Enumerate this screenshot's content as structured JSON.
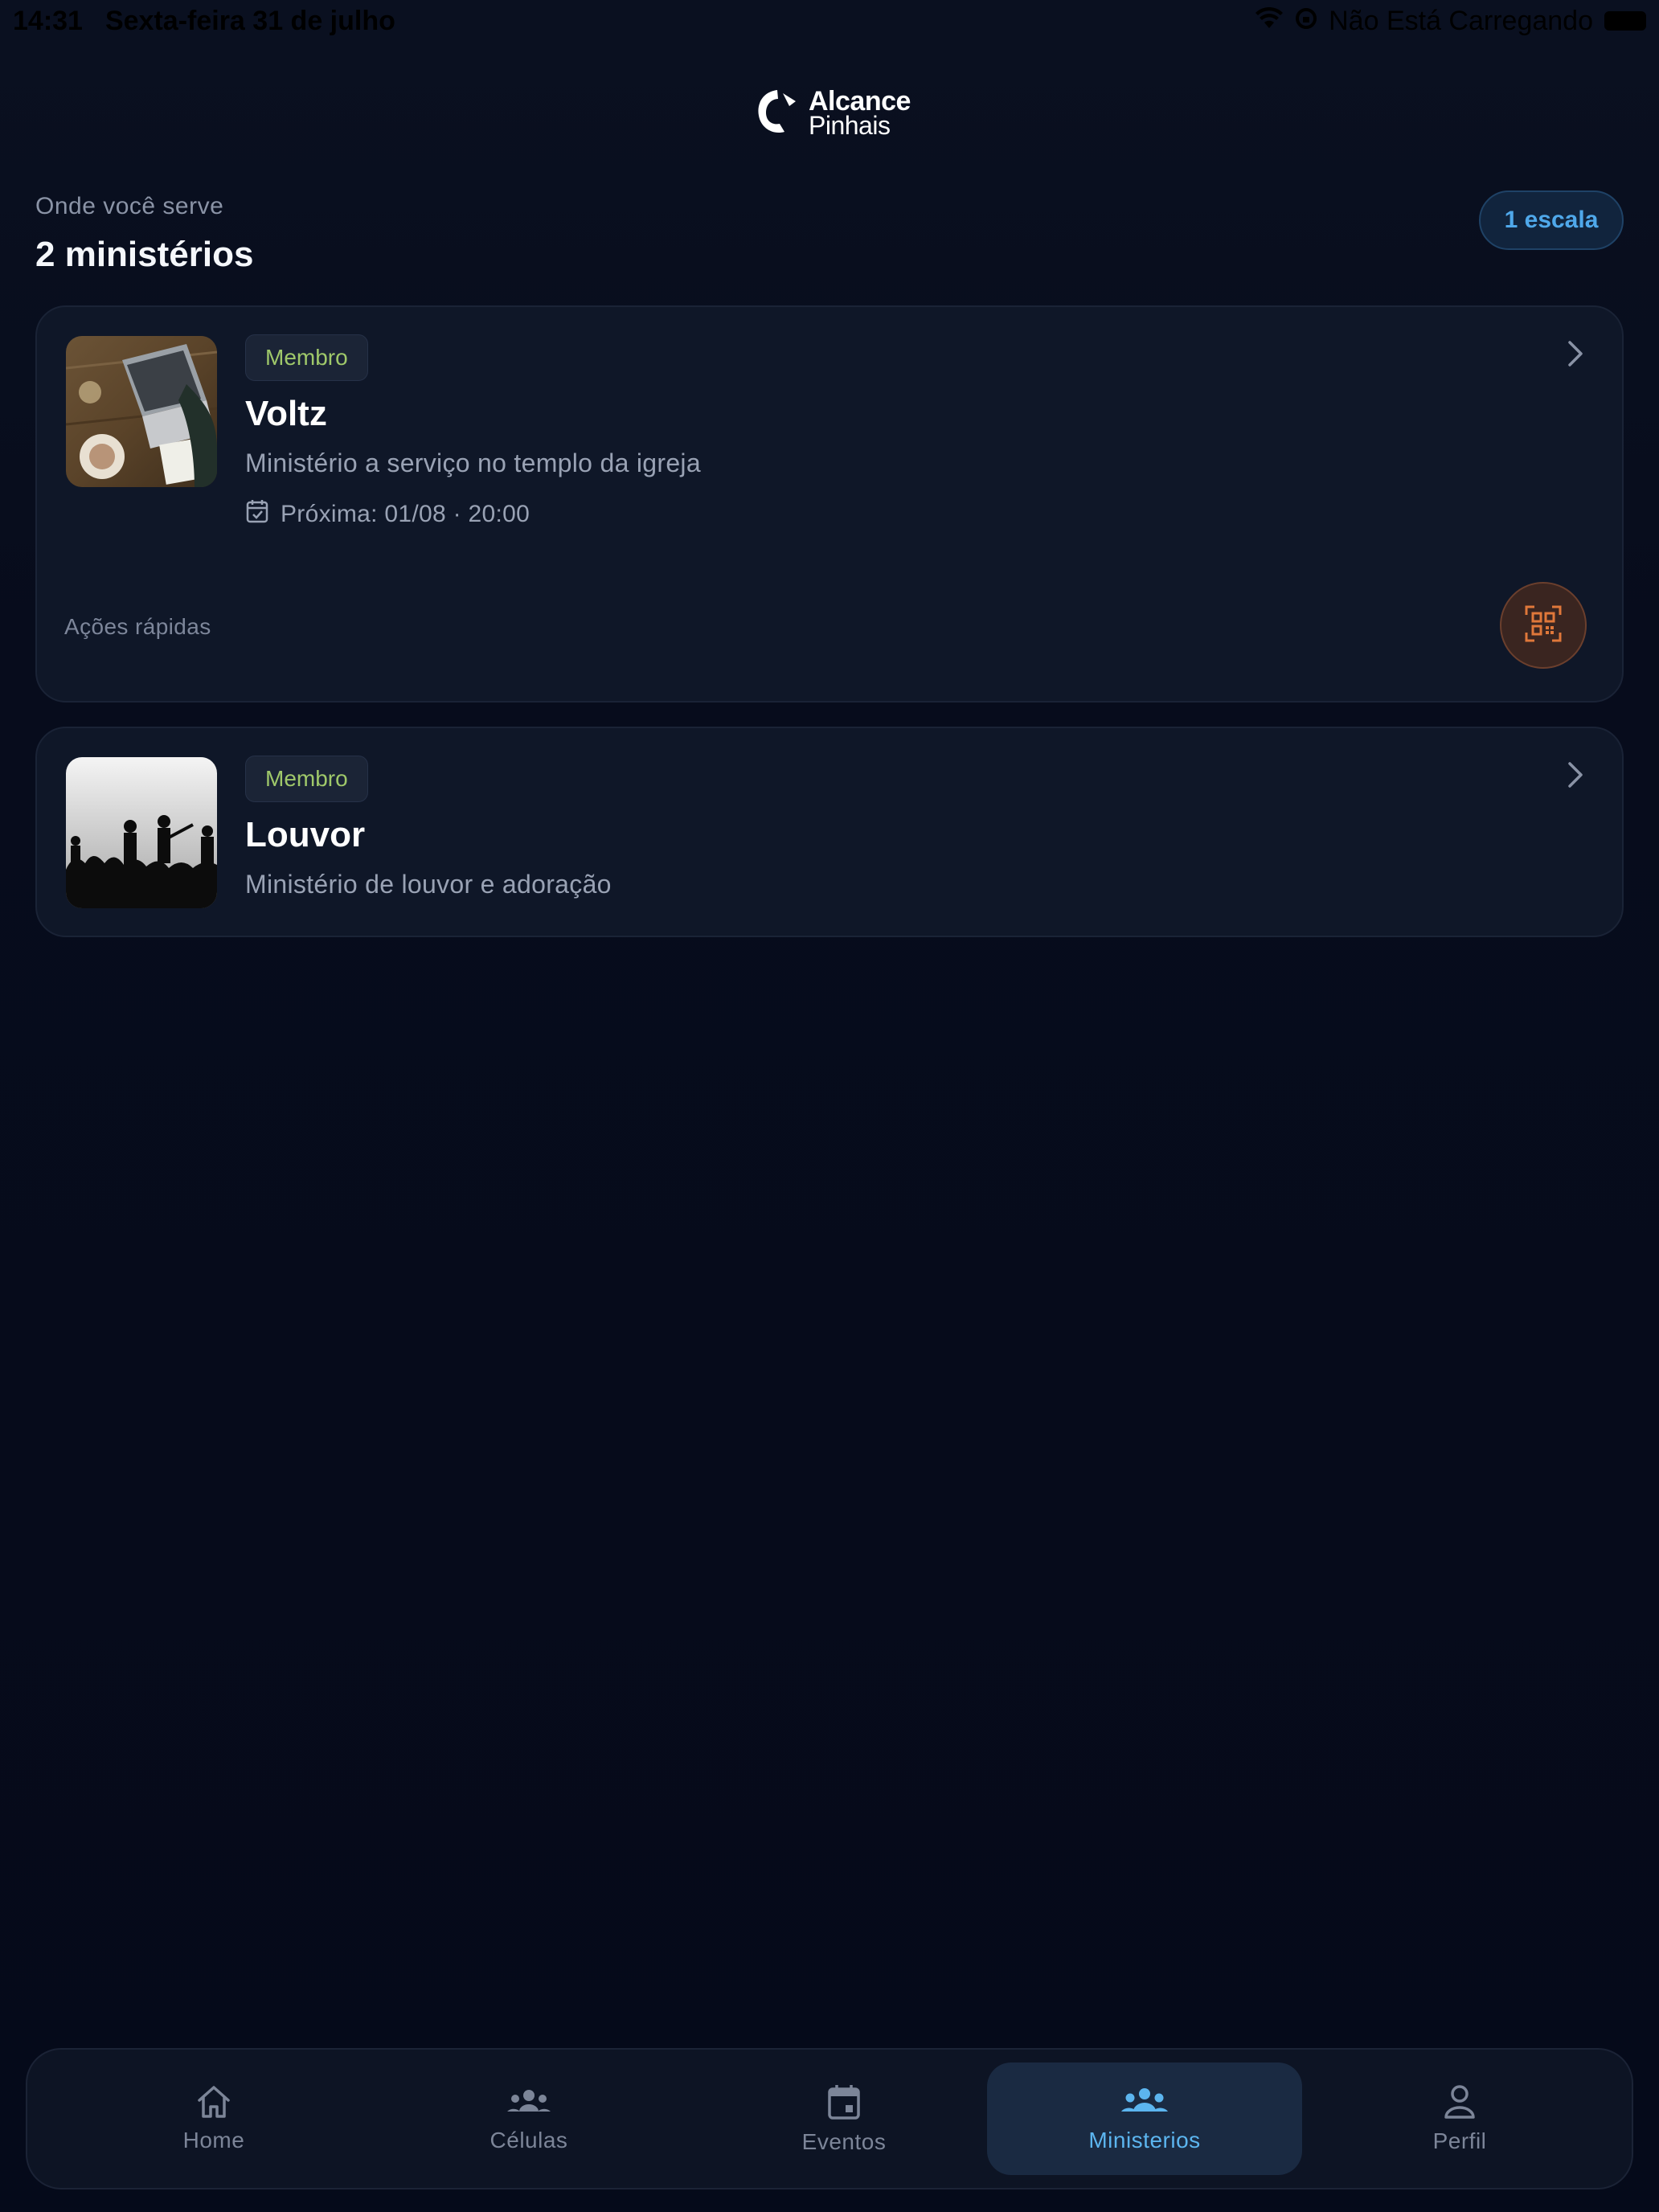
{
  "status_bar": {
    "time": "14:31",
    "date": "Sexta-feira 31 de julho",
    "battery_text": "Não Está Carregando"
  },
  "logo": {
    "line1": "Alcance",
    "line2": "Pinhais"
  },
  "header": {
    "subtitle": "Onde você serve",
    "title": "2 ministérios",
    "badge": "1 escala"
  },
  "ministries": [
    {
      "role": "Membro",
      "name": "Voltz",
      "description": "Ministério a serviço no templo da igreja",
      "next": "Próxima: 01/08 · 20:00",
      "quick_actions_label": "Ações rápidas"
    },
    {
      "role": "Membro",
      "name": "Louvor",
      "description": "Ministério de louvor e adoração"
    }
  ],
  "nav": {
    "items": [
      {
        "label": "Home",
        "icon": "home-icon"
      },
      {
        "label": "Células",
        "icon": "users-icon"
      },
      {
        "label": "Eventos",
        "icon": "calendar-icon"
      },
      {
        "label": "Ministerios",
        "icon": "group-icon",
        "active": true
      },
      {
        "label": "Perfil",
        "icon": "person-icon"
      }
    ]
  },
  "colors": {
    "accent": "#5cb5ef",
    "role_badge_text": "#9fc86a",
    "qr_accent": "#e0783a",
    "background": "#060b1b"
  }
}
